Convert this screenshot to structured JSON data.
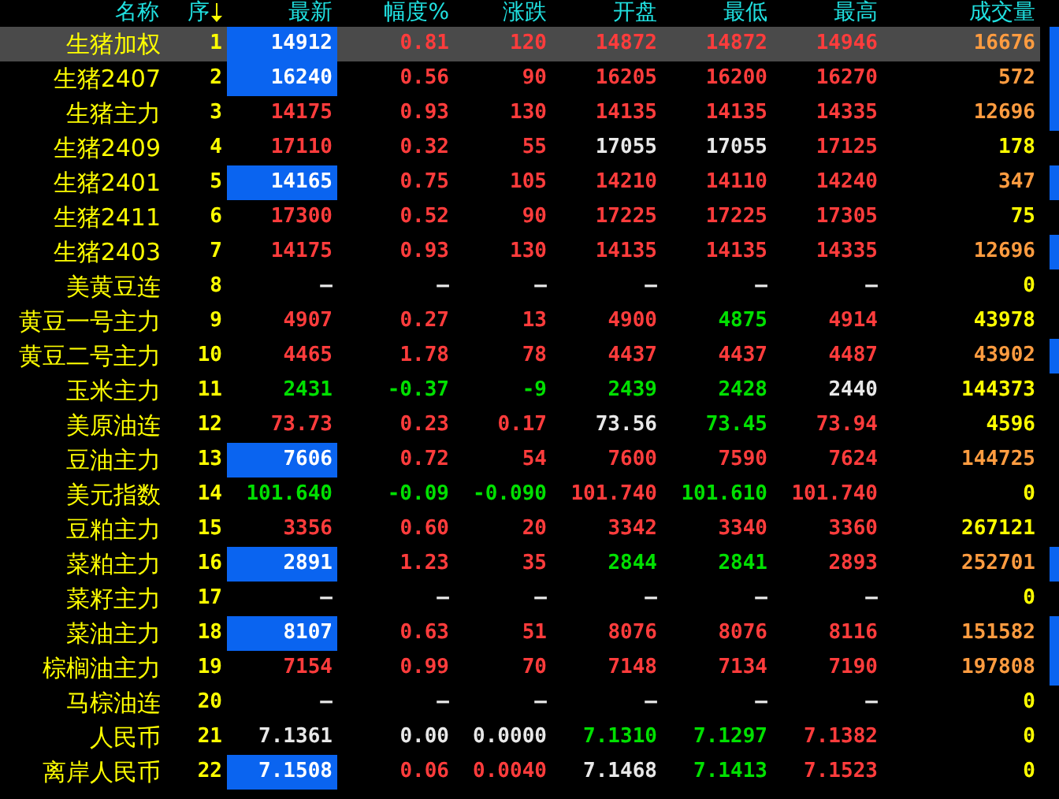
{
  "columns": [
    {
      "label": "名称",
      "sorted": false
    },
    {
      "label": "序",
      "sorted": true
    },
    {
      "label": "最新",
      "sorted": false
    },
    {
      "label": "幅度%",
      "sorted": false
    },
    {
      "label": "涨跌",
      "sorted": false
    },
    {
      "label": "开盘",
      "sorted": false
    },
    {
      "label": "最低",
      "sorted": false
    },
    {
      "label": "最高",
      "sorted": false
    },
    {
      "label": "成交量",
      "sorted": false
    }
  ],
  "rows": [
    {
      "name": "生猪加权",
      "seq": "1",
      "selected": true,
      "flash": true,
      "marker": true,
      "cells": [
        {
          "text": "14912",
          "kind": "bright"
        },
        {
          "text": "0.81",
          "kind": "up"
        },
        {
          "text": "120",
          "kind": "up"
        },
        {
          "text": "14872",
          "kind": "up"
        },
        {
          "text": "14872",
          "kind": "up"
        },
        {
          "text": "14946",
          "kind": "up"
        },
        {
          "text": "16676",
          "kind": "warm"
        }
      ]
    },
    {
      "name": "生猪2407",
      "seq": "2",
      "selected": false,
      "flash": true,
      "marker": true,
      "cells": [
        {
          "text": "16240",
          "kind": "bright"
        },
        {
          "text": "0.56",
          "kind": "up"
        },
        {
          "text": "90",
          "kind": "up"
        },
        {
          "text": "16205",
          "kind": "up"
        },
        {
          "text": "16200",
          "kind": "up"
        },
        {
          "text": "16270",
          "kind": "up"
        },
        {
          "text": "572",
          "kind": "warm"
        }
      ]
    },
    {
      "name": "生猪主力",
      "seq": "3",
      "selected": false,
      "flash": false,
      "marker": true,
      "cells": [
        {
          "text": "14175",
          "kind": "up"
        },
        {
          "text": "0.93",
          "kind": "up"
        },
        {
          "text": "130",
          "kind": "up"
        },
        {
          "text": "14135",
          "kind": "up"
        },
        {
          "text": "14135",
          "kind": "up"
        },
        {
          "text": "14335",
          "kind": "up"
        },
        {
          "text": "12696",
          "kind": "warm"
        }
      ]
    },
    {
      "name": "生猪2409",
      "seq": "4",
      "selected": false,
      "flash": false,
      "marker": false,
      "cells": [
        {
          "text": "17110",
          "kind": "up"
        },
        {
          "text": "0.32",
          "kind": "up"
        },
        {
          "text": "55",
          "kind": "up"
        },
        {
          "text": "17055",
          "kind": "flat"
        },
        {
          "text": "17055",
          "kind": "flat"
        },
        {
          "text": "17125",
          "kind": "up"
        },
        {
          "text": "178",
          "kind": "plain"
        }
      ]
    },
    {
      "name": "生猪2401",
      "seq": "5",
      "selected": false,
      "flash": true,
      "marker": true,
      "cells": [
        {
          "text": "14165",
          "kind": "bright"
        },
        {
          "text": "0.75",
          "kind": "up"
        },
        {
          "text": "105",
          "kind": "up"
        },
        {
          "text": "14210",
          "kind": "up"
        },
        {
          "text": "14110",
          "kind": "up"
        },
        {
          "text": "14240",
          "kind": "up"
        },
        {
          "text": "347",
          "kind": "warm"
        }
      ]
    },
    {
      "name": "生猪2411",
      "seq": "6",
      "selected": false,
      "flash": false,
      "marker": false,
      "cells": [
        {
          "text": "17300",
          "kind": "up"
        },
        {
          "text": "0.52",
          "kind": "up"
        },
        {
          "text": "90",
          "kind": "up"
        },
        {
          "text": "17225",
          "kind": "up"
        },
        {
          "text": "17225",
          "kind": "up"
        },
        {
          "text": "17305",
          "kind": "up"
        },
        {
          "text": "75",
          "kind": "plain"
        }
      ]
    },
    {
      "name": "生猪2403",
      "seq": "7",
      "selected": false,
      "flash": false,
      "marker": true,
      "cells": [
        {
          "text": "14175",
          "kind": "up"
        },
        {
          "text": "0.93",
          "kind": "up"
        },
        {
          "text": "130",
          "kind": "up"
        },
        {
          "text": "14135",
          "kind": "up"
        },
        {
          "text": "14135",
          "kind": "up"
        },
        {
          "text": "14335",
          "kind": "up"
        },
        {
          "text": "12696",
          "kind": "warm"
        }
      ]
    },
    {
      "name": "美黄豆连",
      "seq": "8",
      "selected": false,
      "flash": false,
      "marker": false,
      "cells": [
        {
          "text": "—",
          "kind": "flat"
        },
        {
          "text": "—",
          "kind": "flat"
        },
        {
          "text": "—",
          "kind": "flat"
        },
        {
          "text": "—",
          "kind": "flat"
        },
        {
          "text": "—",
          "kind": "flat"
        },
        {
          "text": "—",
          "kind": "flat"
        },
        {
          "text": "0",
          "kind": "plain"
        }
      ]
    },
    {
      "name": "黄豆一号主力",
      "seq": "9",
      "selected": false,
      "flash": false,
      "marker": false,
      "cells": [
        {
          "text": "4907",
          "kind": "up"
        },
        {
          "text": "0.27",
          "kind": "up"
        },
        {
          "text": "13",
          "kind": "up"
        },
        {
          "text": "4900",
          "kind": "up"
        },
        {
          "text": "4875",
          "kind": "down"
        },
        {
          "text": "4914",
          "kind": "up"
        },
        {
          "text": "43978",
          "kind": "plain"
        }
      ]
    },
    {
      "name": "黄豆二号主力",
      "seq": "10",
      "selected": false,
      "flash": false,
      "marker": true,
      "cells": [
        {
          "text": "4465",
          "kind": "up"
        },
        {
          "text": "1.78",
          "kind": "up"
        },
        {
          "text": "78",
          "kind": "up"
        },
        {
          "text": "4437",
          "kind": "up"
        },
        {
          "text": "4437",
          "kind": "up"
        },
        {
          "text": "4487",
          "kind": "up"
        },
        {
          "text": "43902",
          "kind": "warm"
        }
      ]
    },
    {
      "name": "玉米主力",
      "seq": "11",
      "selected": false,
      "flash": false,
      "marker": false,
      "cells": [
        {
          "text": "2431",
          "kind": "down"
        },
        {
          "text": "-0.37",
          "kind": "down"
        },
        {
          "text": "-9",
          "kind": "down"
        },
        {
          "text": "2439",
          "kind": "down"
        },
        {
          "text": "2428",
          "kind": "down"
        },
        {
          "text": "2440",
          "kind": "flat"
        },
        {
          "text": "144373",
          "kind": "plain"
        }
      ]
    },
    {
      "name": "美原油连",
      "seq": "12",
      "selected": false,
      "flash": false,
      "marker": false,
      "cells": [
        {
          "text": "73.73",
          "kind": "up"
        },
        {
          "text": "0.23",
          "kind": "up"
        },
        {
          "text": "0.17",
          "kind": "up"
        },
        {
          "text": "73.56",
          "kind": "flat"
        },
        {
          "text": "73.45",
          "kind": "down"
        },
        {
          "text": "73.94",
          "kind": "up"
        },
        {
          "text": "4596",
          "kind": "plain"
        }
      ]
    },
    {
      "name": "豆油主力",
      "seq": "13",
      "selected": false,
      "flash": true,
      "marker": false,
      "cells": [
        {
          "text": "7606",
          "kind": "bright"
        },
        {
          "text": "0.72",
          "kind": "up"
        },
        {
          "text": "54",
          "kind": "up"
        },
        {
          "text": "7600",
          "kind": "up"
        },
        {
          "text": "7590",
          "kind": "up"
        },
        {
          "text": "7624",
          "kind": "up"
        },
        {
          "text": "144725",
          "kind": "warm"
        }
      ]
    },
    {
      "name": "美元指数",
      "seq": "14",
      "selected": false,
      "flash": false,
      "marker": false,
      "cells": [
        {
          "text": "101.640",
          "kind": "down"
        },
        {
          "text": "-0.09",
          "kind": "down"
        },
        {
          "text": "-0.090",
          "kind": "down"
        },
        {
          "text": "101.740",
          "kind": "up"
        },
        {
          "text": "101.610",
          "kind": "down"
        },
        {
          "text": "101.740",
          "kind": "up"
        },
        {
          "text": "0",
          "kind": "plain"
        }
      ]
    },
    {
      "name": "豆粕主力",
      "seq": "15",
      "selected": false,
      "flash": false,
      "marker": false,
      "cells": [
        {
          "text": "3356",
          "kind": "up"
        },
        {
          "text": "0.60",
          "kind": "up"
        },
        {
          "text": "20",
          "kind": "up"
        },
        {
          "text": "3342",
          "kind": "up"
        },
        {
          "text": "3340",
          "kind": "up"
        },
        {
          "text": "3360",
          "kind": "up"
        },
        {
          "text": "267121",
          "kind": "plain"
        }
      ]
    },
    {
      "name": "菜粕主力",
      "seq": "16",
      "selected": false,
      "flash": true,
      "marker": true,
      "cells": [
        {
          "text": "2891",
          "kind": "bright"
        },
        {
          "text": "1.23",
          "kind": "up"
        },
        {
          "text": "35",
          "kind": "up"
        },
        {
          "text": "2844",
          "kind": "down"
        },
        {
          "text": "2841",
          "kind": "down"
        },
        {
          "text": "2893",
          "kind": "up"
        },
        {
          "text": "252701",
          "kind": "warm"
        }
      ]
    },
    {
      "name": "菜籽主力",
      "seq": "17",
      "selected": false,
      "flash": false,
      "marker": false,
      "cells": [
        {
          "text": "—",
          "kind": "flat"
        },
        {
          "text": "—",
          "kind": "flat"
        },
        {
          "text": "—",
          "kind": "flat"
        },
        {
          "text": "—",
          "kind": "flat"
        },
        {
          "text": "—",
          "kind": "flat"
        },
        {
          "text": "—",
          "kind": "flat"
        },
        {
          "text": "0",
          "kind": "plain"
        }
      ]
    },
    {
      "name": "菜油主力",
      "seq": "18",
      "selected": false,
      "flash": true,
      "marker": true,
      "cells": [
        {
          "text": "8107",
          "kind": "bright"
        },
        {
          "text": "0.63",
          "kind": "up"
        },
        {
          "text": "51",
          "kind": "up"
        },
        {
          "text": "8076",
          "kind": "up"
        },
        {
          "text": "8076",
          "kind": "up"
        },
        {
          "text": "8116",
          "kind": "up"
        },
        {
          "text": "151582",
          "kind": "warm"
        }
      ]
    },
    {
      "name": "棕榈油主力",
      "seq": "19",
      "selected": false,
      "flash": false,
      "marker": true,
      "cells": [
        {
          "text": "7154",
          "kind": "up"
        },
        {
          "text": "0.99",
          "kind": "up"
        },
        {
          "text": "70",
          "kind": "up"
        },
        {
          "text": "7148",
          "kind": "up"
        },
        {
          "text": "7134",
          "kind": "up"
        },
        {
          "text": "7190",
          "kind": "up"
        },
        {
          "text": "197808",
          "kind": "warm"
        }
      ]
    },
    {
      "name": "马棕油连",
      "seq": "20",
      "selected": false,
      "flash": false,
      "marker": false,
      "cells": [
        {
          "text": "—",
          "kind": "flat"
        },
        {
          "text": "—",
          "kind": "flat"
        },
        {
          "text": "—",
          "kind": "flat"
        },
        {
          "text": "—",
          "kind": "flat"
        },
        {
          "text": "—",
          "kind": "flat"
        },
        {
          "text": "—",
          "kind": "flat"
        },
        {
          "text": "0",
          "kind": "plain"
        }
      ]
    },
    {
      "name": "人民币",
      "seq": "21",
      "selected": false,
      "flash": false,
      "marker": false,
      "cells": [
        {
          "text": "7.1361",
          "kind": "flat"
        },
        {
          "text": "0.00",
          "kind": "flat"
        },
        {
          "text": "0.0000",
          "kind": "flat"
        },
        {
          "text": "7.1310",
          "kind": "down"
        },
        {
          "text": "7.1297",
          "kind": "down"
        },
        {
          "text": "7.1382",
          "kind": "up"
        },
        {
          "text": "0",
          "kind": "plain"
        }
      ]
    },
    {
      "name": "离岸人民币",
      "seq": "22",
      "selected": false,
      "flash": true,
      "marker": false,
      "cells": [
        {
          "text": "7.1508",
          "kind": "bright"
        },
        {
          "text": "0.06",
          "kind": "up"
        },
        {
          "text": "0.0040",
          "kind": "up"
        },
        {
          "text": "7.1468",
          "kind": "flat"
        },
        {
          "text": "7.1413",
          "kind": "down"
        },
        {
          "text": "7.1523",
          "kind": "up"
        },
        {
          "text": "0",
          "kind": "plain"
        }
      ]
    }
  ]
}
